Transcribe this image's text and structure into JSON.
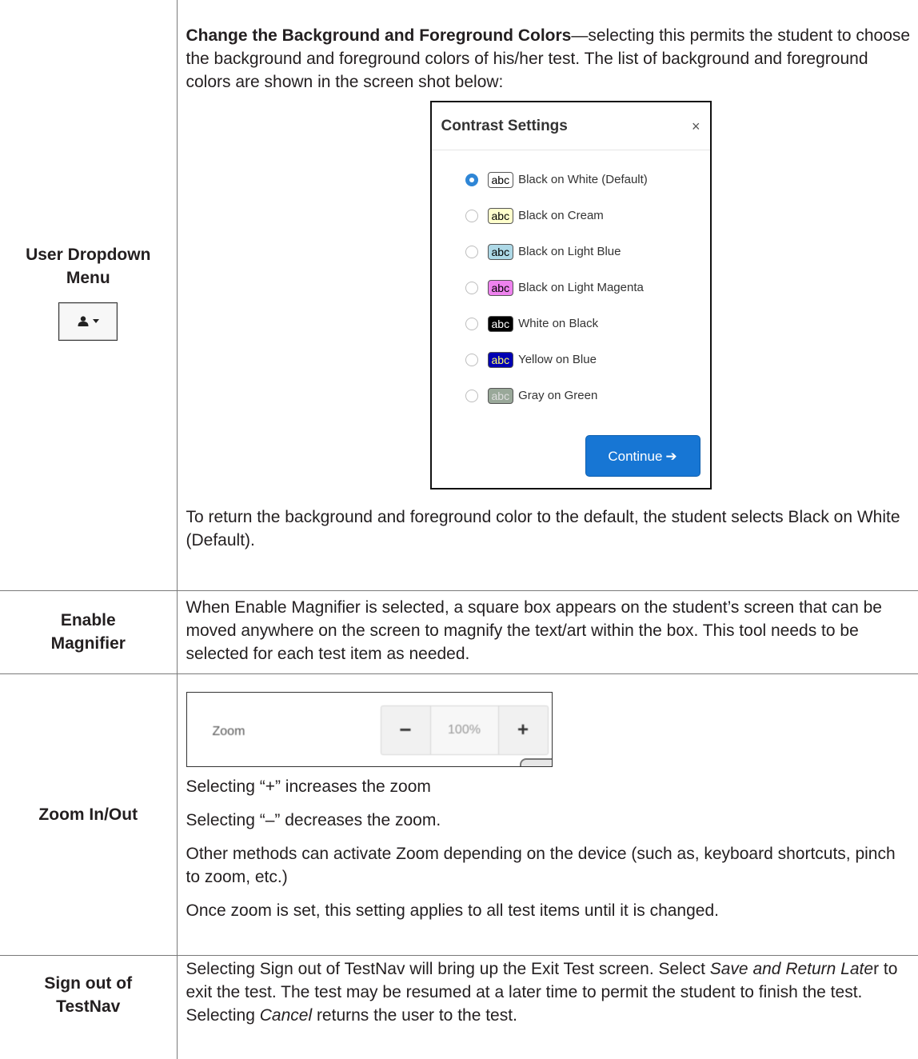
{
  "rows": {
    "user": {
      "label": "User Dropdown Menu",
      "bold_intro": "Change the Background and Foreground Colors",
      "intro_rest": "—selecting this permits the student to choose the background and foreground colors of his/her test. The list of background and foreground colors are shown in the screen shot below:",
      "dialog": {
        "title": "Contrast Settings",
        "close": "×",
        "options": [
          {
            "abc": "abc",
            "label": "Black on White (Default)",
            "bg": "#ffffff",
            "fg": "#000000",
            "selected": true
          },
          {
            "abc": "abc",
            "label": "Black on Cream",
            "bg": "#ffffcc",
            "fg": "#000000",
            "selected": false
          },
          {
            "abc": "abc",
            "label": "Black on Light Blue",
            "bg": "#add8e6",
            "fg": "#000000",
            "selected": false
          },
          {
            "abc": "abc",
            "label": "Black on Light Magenta",
            "bg": "#ee82ee",
            "fg": "#000000",
            "selected": false
          },
          {
            "abc": "abc",
            "label": "White on Black",
            "bg": "#000000",
            "fg": "#ffffff",
            "selected": false
          },
          {
            "abc": "abc",
            "label": "Yellow on Blue",
            "bg": "#0000b3",
            "fg": "#ffff66",
            "selected": false
          },
          {
            "abc": "abc",
            "label": "Gray on Green",
            "bg": "#99a899",
            "fg": "#dddddd",
            "selected": false
          }
        ],
        "continue_label": "Continue",
        "continue_arrow": "➔"
      },
      "outro": "To return the background and foreground color to the default, the student selects Black on White (Default)."
    },
    "magnifier": {
      "label": "Enable Magnifier",
      "text": "When Enable Magnifier is selected, a square box appears on the student’s screen that can be moved anywhere on the screen to magnify the text/art within the box. This tool needs to be selected for each test item as needed."
    },
    "zoom": {
      "label": "Zoom In/Out",
      "widget": {
        "label": "Zoom",
        "minus": "−",
        "value": "100%",
        "plus": "+"
      },
      "p1": "Selecting “+” increases the zoom",
      "p2": "Selecting “–” decreases the zoom.",
      "p3": "Other methods can activate Zoom depending on the device (such as, keyboard shortcuts, pinch to zoom, etc.)",
      "p4": "Once zoom is set, this setting applies to all test items until it is changed."
    },
    "signout": {
      "label": "Sign out of TestNav",
      "t1": "Selecting Sign out of TestNav will bring up the Exit Test screen. Select ",
      "i1": "Save and Return Late",
      "t2": "r to exit the test. The test may be resumed at a later time to permit the student to finish the test. Selecting ",
      "i2": "Cancel",
      "t3": " returns the user to the test."
    }
  },
  "icons": {
    "user": "user-icon",
    "caret": "caret-down-icon",
    "arrow": "arrow-right-icon"
  },
  "colors": {
    "continue_button": "#1776d4",
    "radio_selected": "#2f86d6"
  }
}
